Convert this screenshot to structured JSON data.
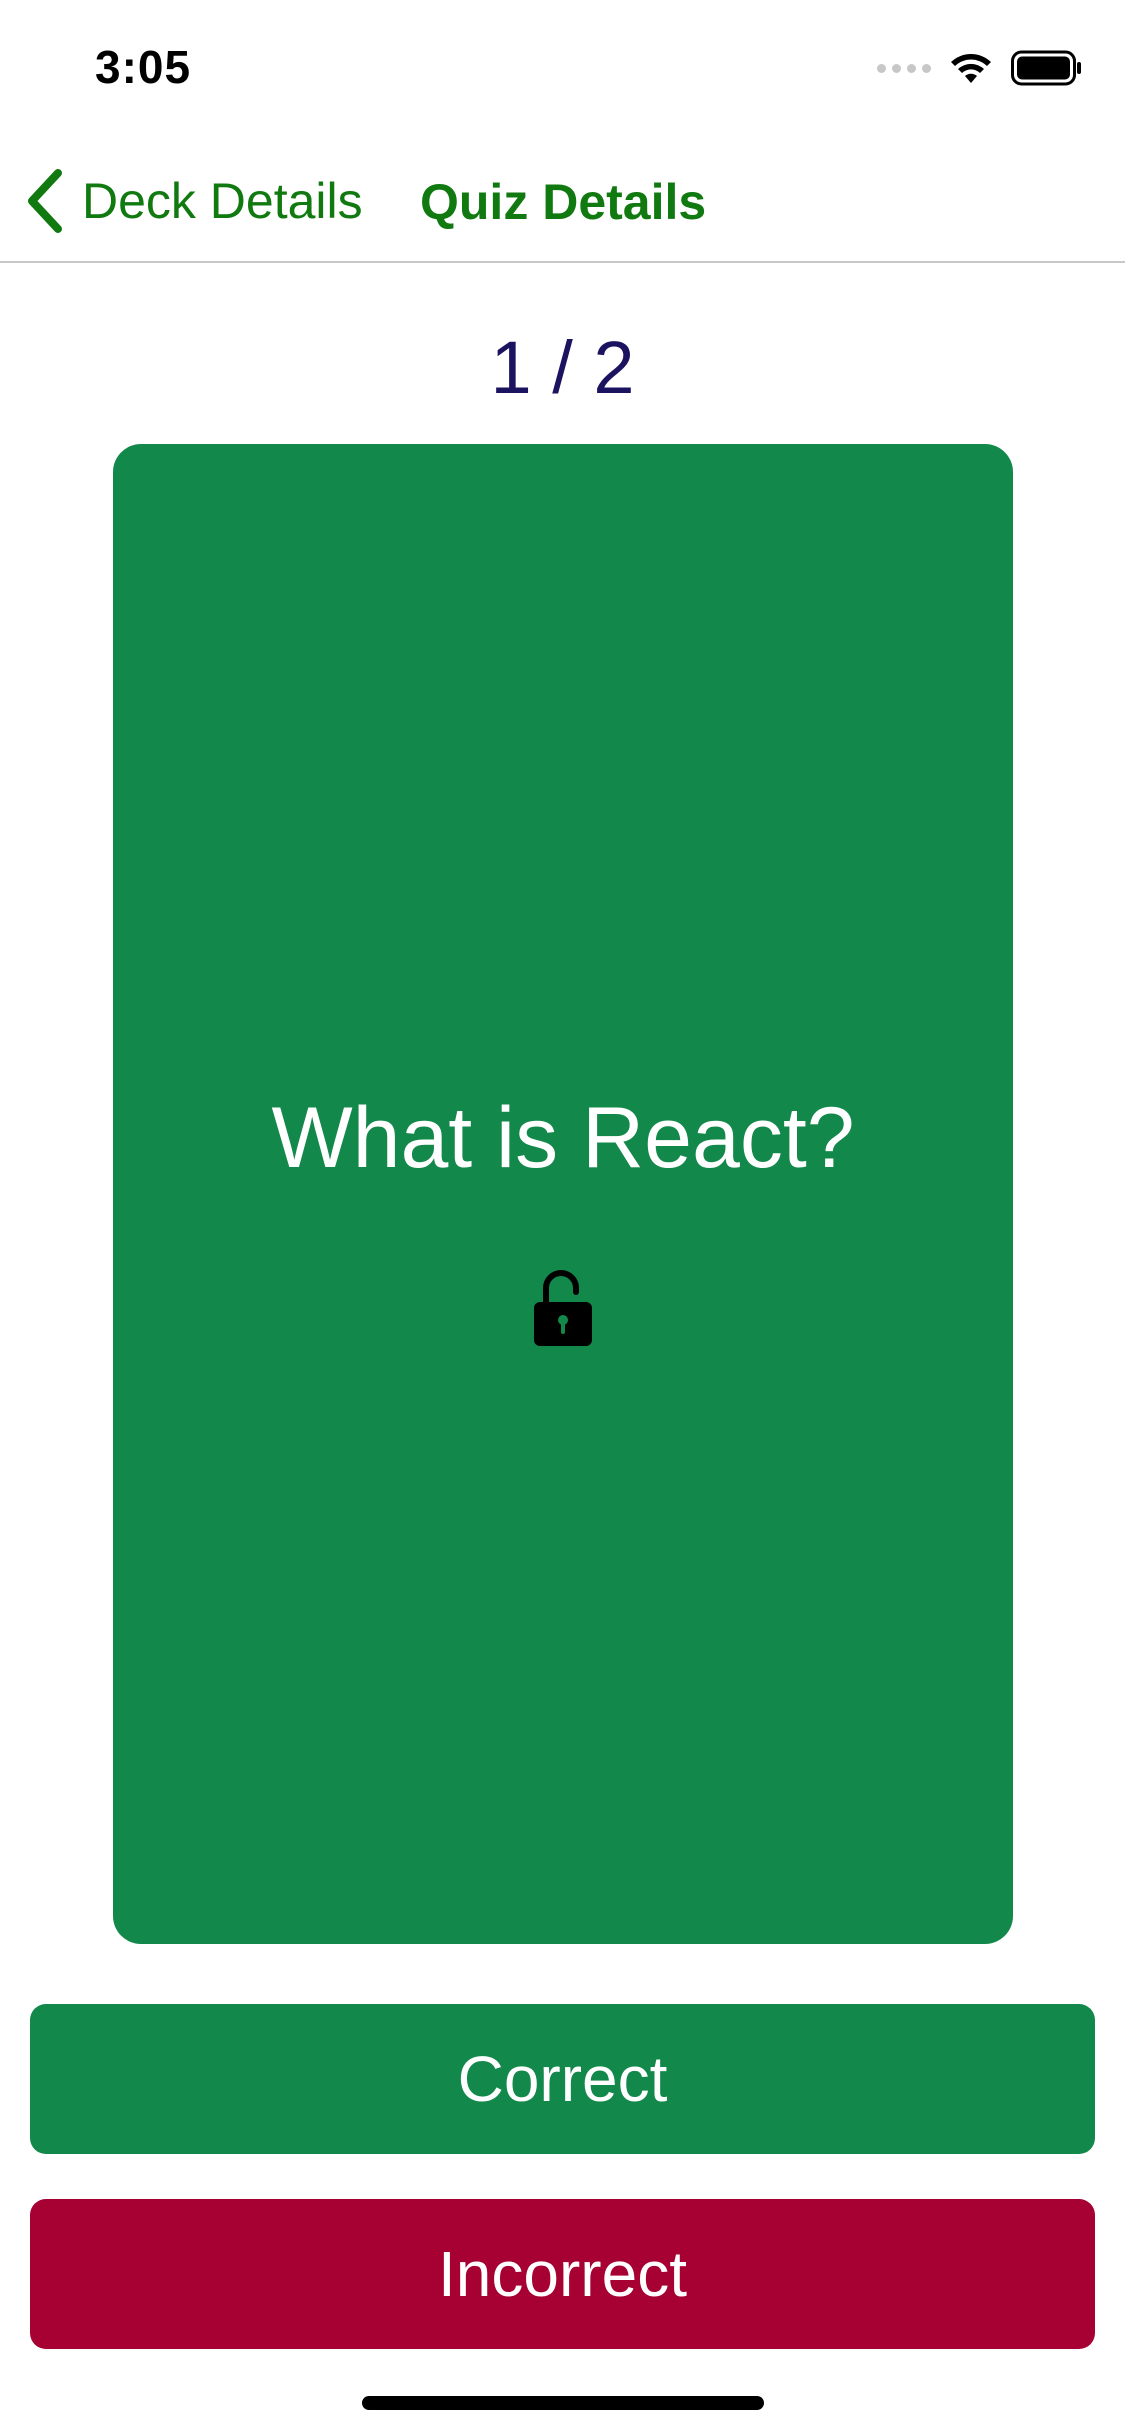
{
  "status_bar": {
    "time": "3:05"
  },
  "nav": {
    "back_label": "Deck Details",
    "title": "Quiz Details",
    "accent_color": "#107a10"
  },
  "quiz": {
    "progress": "1 / 2",
    "question": "What is React?",
    "lock_icon": "unlocked-padlock-icon",
    "card_color": "#13884b"
  },
  "actions": {
    "correct_label": "Correct",
    "incorrect_label": "Incorrect",
    "correct_color": "#13884b",
    "incorrect_color": "#a70032"
  }
}
